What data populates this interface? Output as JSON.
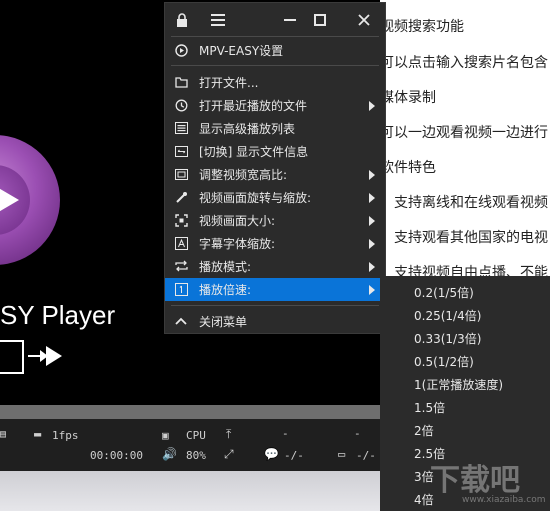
{
  "doc": {
    "lines": [
      "视频搜索功能",
      "可以点击输入搜索片名包含",
      "媒体录制",
      "可以一边观看视频一边进行",
      "软件特色",
      "、支持离线和在线观看视频",
      "、支持观看其他国家的电视",
      "、支持视频自由点播、不能"
    ]
  },
  "player": {
    "title": "SY Player",
    "controls": {
      "fps": "1fps",
      "cpu_label": "CPU",
      "time": "00:00:00",
      "volume": "80%",
      "dash1": "-",
      "dash2": "-",
      "subtitle_value": "-/-",
      "audio_value": "-/-"
    }
  },
  "menu": {
    "top_icons": [
      "lock-icon",
      "hamburger-icon",
      "minus-icon",
      "maximize-icon",
      "close-icon"
    ],
    "settings_label": "MPV-EASY设置",
    "items": [
      {
        "label": "打开文件...",
        "icon": "folder-icon",
        "submenu": false
      },
      {
        "label": "打开最近播放的文件",
        "icon": "history-icon",
        "submenu": true
      },
      {
        "label": "显示高级播放列表",
        "icon": "list-icon",
        "submenu": false
      },
      {
        "label": "[切换] 显示文件信息",
        "icon": "info-toggle-icon",
        "submenu": false
      },
      {
        "label": "调整视频宽高比:",
        "icon": "aspect-icon",
        "submenu": true
      },
      {
        "label": "视频画面旋转与缩放:",
        "icon": "rotate-icon",
        "submenu": true
      },
      {
        "label": "视频画面大小:",
        "icon": "size-icon",
        "submenu": true
      },
      {
        "label": "字幕字体缩放:",
        "icon": "font-icon",
        "submenu": true
      },
      {
        "label": "播放模式:",
        "icon": "repeat-icon",
        "submenu": true
      },
      {
        "label": "播放倍速:",
        "icon": "speed-icon",
        "submenu": true,
        "highlighted": true
      }
    ],
    "close_label": "关闭菜单",
    "highlight_color": "#0a74d8"
  },
  "speed_submenu": {
    "items": [
      "0.2(1/5倍)",
      "0.25(1/4倍)",
      "0.33(1/3倍)",
      "0.5(1/2倍)",
      "1(正常播放速度)",
      "1.5倍",
      "2倍",
      "2.5倍",
      "3倍",
      "4倍"
    ]
  },
  "watermark": {
    "text": "下载吧",
    "sub": "www.xiazaiba.com"
  }
}
